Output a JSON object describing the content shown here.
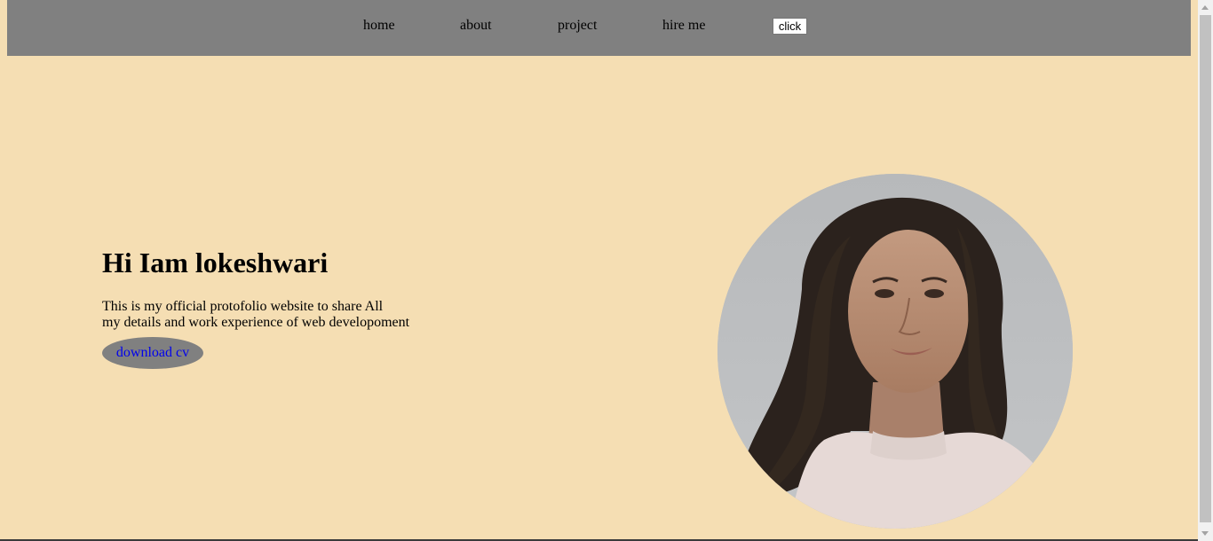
{
  "nav": {
    "items": [
      "home",
      "about",
      "project",
      "hire me"
    ],
    "button_label": "click"
  },
  "hero": {
    "title": "Hi Iam lokeshwari",
    "description_line1": "This is my official protofolio website to share All",
    "description_line2": "my details and work experience of web developoment",
    "cv_label": "download cv"
  },
  "colors": {
    "page_background": "#f5deb3",
    "nav_background": "#808080",
    "button_background": "#808080",
    "link_color": "#0000ee"
  },
  "icons": [
    "portrait-photo",
    "scroll-up-arrow",
    "scroll-down-arrow"
  ]
}
